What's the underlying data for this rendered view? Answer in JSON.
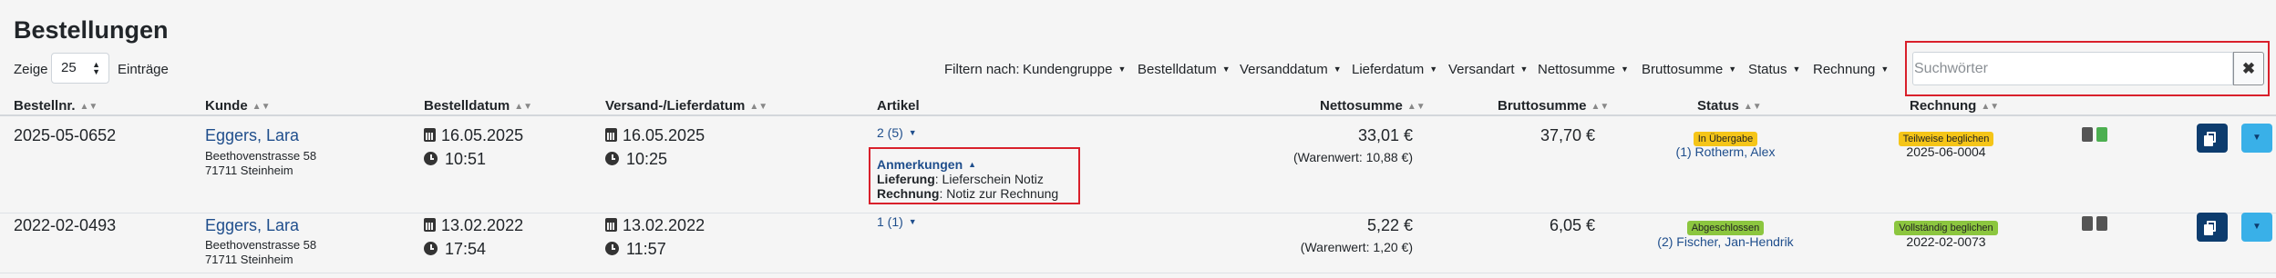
{
  "page": {
    "title": "Bestellungen"
  },
  "length": {
    "show": "Zeige",
    "value": "25",
    "entries": "Einträge"
  },
  "filters": {
    "label": "Filtern nach:",
    "items": [
      "Kundengruppe",
      "Bestelldatum",
      "Versanddatum",
      "Lieferdatum",
      "Versandart",
      "Nettosumme",
      "Bruttosumme",
      "Status",
      "Rechnung"
    ]
  },
  "search": {
    "placeholder": "Suchwörter",
    "clear": "✖"
  },
  "columns": [
    "Bestellnr.",
    "Kunde",
    "Bestelldatum",
    "Versand-/Lieferdatum",
    "Artikel",
    "Nettosumme",
    "Bruttosumme",
    "Status",
    "Rechnung"
  ],
  "orders": [
    {
      "number": "2025-05-0652",
      "customer": "Eggers, Lara",
      "street": "Beethovenstrasse 58",
      "city": "71711 Steinheim",
      "order_date": "16.05.2025",
      "order_time": "10:51",
      "ship_date": "16.05.2025",
      "ship_time": "10:25",
      "articles": "2 (5)",
      "notes": {
        "title": "Anmerkungen",
        "delivery_label": "Lieferung",
        "delivery_text": ": Lieferschein Notiz",
        "invoice_label": "Rechnung",
        "invoice_text": ": Notiz zur Rechnung"
      },
      "net": "33,01 €",
      "goods_value": "(Warenwert: 10,88 €)",
      "gross": "37,70 €",
      "status": "In Übergabe",
      "assignee": "(1) Rotherm, Alex",
      "invoice_status": "Teilweise beglichen",
      "invoice_number": "2025-06-0004"
    },
    {
      "number": "2022-02-0493",
      "customer": "Eggers, Lara",
      "street": "Beethovenstrasse 58",
      "city": "71711 Steinheim",
      "order_date": "13.02.2022",
      "order_time": "17:54",
      "ship_date": "13.02.2022",
      "ship_time": "11:57",
      "articles": "1 (1)",
      "net": "5,22 €",
      "goods_value": "(Warenwert: 1,20 €)",
      "gross": "6,05 €",
      "status": "Abgeschlossen",
      "assignee": "(2) Fischer, Jan-Hendrik",
      "invoice_status": "Vollständig beglichen",
      "invoice_number": "2022-02-0073"
    }
  ],
  "colors": {
    "link": "#1f4e8c",
    "highlight": "#d9202b",
    "badge_yellow": "#f5c518",
    "badge_green": "#8cc63f",
    "button_dark": "#0d3c6e",
    "button_light": "#39b0e8"
  }
}
